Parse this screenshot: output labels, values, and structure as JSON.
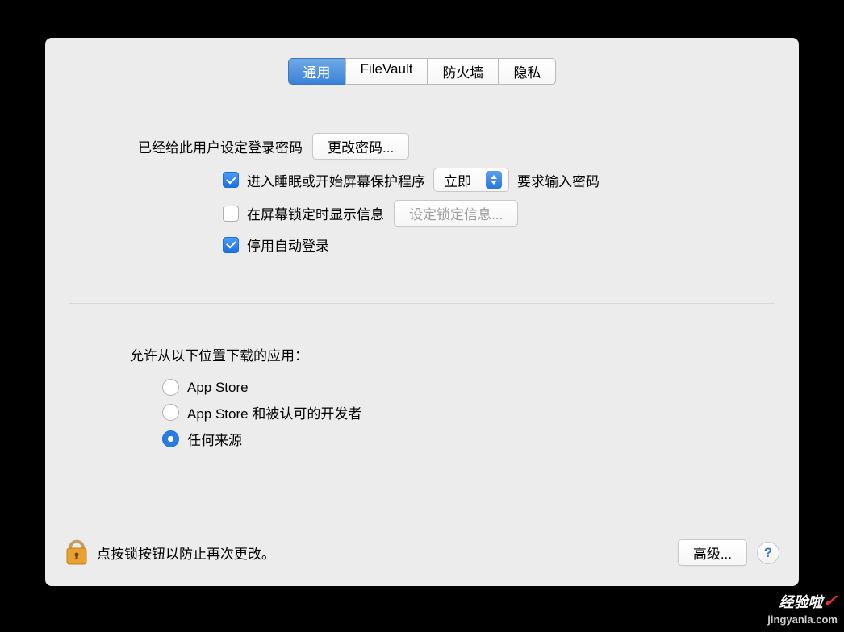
{
  "tabs": {
    "general": "通用",
    "filevault": "FileVault",
    "firewall": "防火墙",
    "privacy": "隐私"
  },
  "password": {
    "set_label": "已经给此用户设定登录密码",
    "change_button": "更改密码..."
  },
  "options": {
    "require_checkbox_checked": true,
    "require_prefix": "进入睡眠或开始屏幕保护程序",
    "require_select_value": "立即",
    "require_suffix": "要求输入密码",
    "show_message_checked": false,
    "show_message_label": "在屏幕锁定时显示信息",
    "set_lock_message_button": "设定锁定信息...",
    "disable_auto_login_checked": true,
    "disable_auto_login_label": "停用自动登录"
  },
  "download": {
    "title": "允许从以下位置下载的应用：",
    "opt_appstore": "App Store",
    "opt_identified": "App Store 和被认可的开发者",
    "opt_anywhere": "任何来源",
    "selected": "anywhere"
  },
  "footer": {
    "lock_text": "点按锁按钮以防止再次更改。",
    "advanced_button": "高级...",
    "help_label": "?"
  },
  "watermark": {
    "text": "经验啦",
    "url": "jingyanla.com"
  }
}
